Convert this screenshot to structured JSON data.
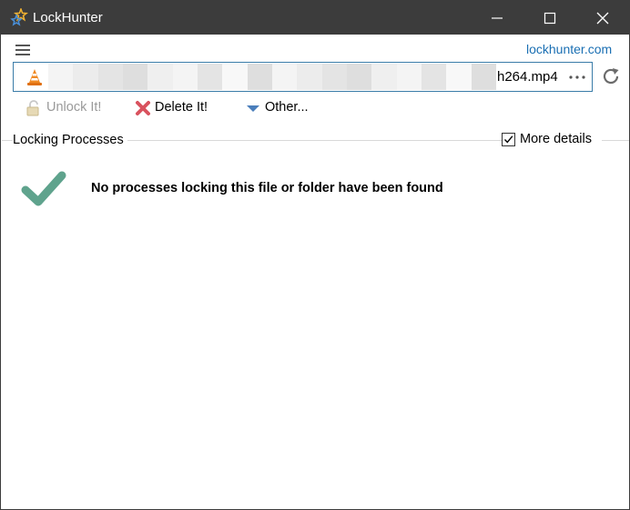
{
  "window": {
    "title": "LockHunter",
    "app_icon": "lockhunter-star-icon",
    "controls": [
      "minimize-icon",
      "maximize-icon",
      "close-icon"
    ]
  },
  "header": {
    "menu_icon": "hamburger-icon",
    "site_link": "lockhunter.com"
  },
  "path": {
    "file_icon": "vlc-cone-icon",
    "visible_text": "h264.mp4",
    "browse_icon": "more-ellipsis-icon",
    "refresh_icon": "refresh-icon"
  },
  "actions": {
    "unlock": {
      "label": "Unlock It!",
      "icon": "unlock-padlock-icon",
      "enabled": false
    },
    "delete": {
      "label": "Delete It!",
      "icon": "delete-x-icon",
      "enabled": true
    },
    "other": {
      "label": "Other...",
      "icon": "dropdown-triangle-icon",
      "enabled": true
    }
  },
  "processes": {
    "section_title": "Locking Processes",
    "more_details_label": "More details",
    "more_details_checked": true,
    "status_icon": "checkmark-icon",
    "status_message": "No processes locking this file or folder have been found"
  },
  "colors": {
    "titlebar": "#3c3c3c",
    "link": "#1a6fb3",
    "path_border": "#3a7ca8",
    "check_green": "#5fa38d",
    "delete_red": "#d9525e",
    "other_blue": "#4a7ebb"
  }
}
